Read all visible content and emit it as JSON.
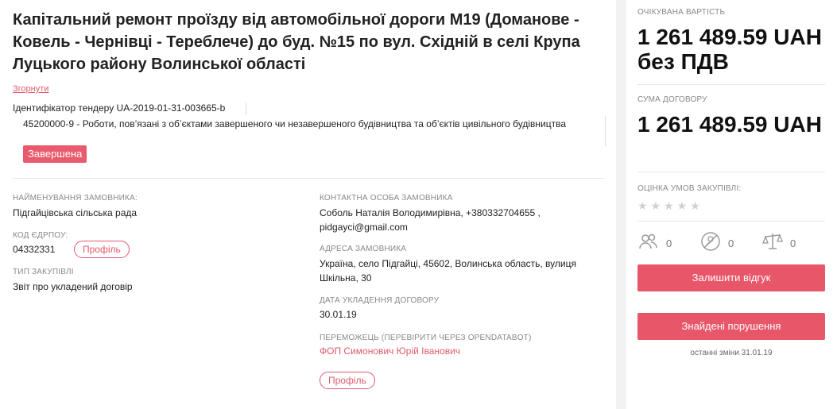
{
  "tender": {
    "title": "Капітальний ремонт проїзду від автомобільної дороги М19 (Доманове - Ковель - Чернівці - Тереблече) до буд. №15 по вул. Східній в селі Крупа Луцького району Волинської області",
    "collapse_label": "Згорнути",
    "tender_id": "Ідентифікатор тендеру UA-2019-01-31-003665-b",
    "cpv": "45200000-9 - Роботи, пов’язані з об’єктами завершеного чи незавершеного будівництва та об’єктів цивільного будівництва",
    "status": "Завершена"
  },
  "details": {
    "customer_label": "НАЙМЕНУВАННЯ ЗАМОВНИКА:",
    "customer_value": "Підгайцівська сільська рада",
    "edrpou_label": "КОД ЄДРПОУ:",
    "edrpou_value": "04332331",
    "profile_label": "Профіль",
    "type_label": "ТИП ЗАКУПІВЛІ",
    "type_value": "Звіт про укладений договір",
    "contact_label": "КОНТАКТНА ОСОБА ЗАМОВНИКА",
    "contact_value": "Соболь Наталія Володимирівна, +380332704655 , pidgayci@gmail.com",
    "address_label": "АДРЕСА ЗАМОВНИКА",
    "address_value": "Україна, село Підгайці, 45602, Волинська область, вулиця Шкільна, 30",
    "date_label": "ДАТА УКЛАДЕННЯ ДОГОВОРУ",
    "date_value": "30.01.19",
    "winner_label": "ПЕРЕМОЖЕЦЬ (ПЕРЕВІРИТИ ЧЕРЕЗ OPENDATABOT)",
    "winner_value": "ФОП Симонович Юрій Іванович",
    "winner_profile_label": "Профіль"
  },
  "aside": {
    "expected_label": "ОЧІКУВАНА ВАРТІСТЬ",
    "expected_value": "1 261 489.59 UAH без ПДВ",
    "contract_label": "СУМА ДОГОВОРУ",
    "contract_value": "1 261 489.59 UAH",
    "rating_label": "ОЦІНКА УМОВ ЗАКУПІВЛІ:",
    "stars": "★★★★★",
    "rating_stars_filled": 0,
    "stat_users": "0",
    "stat_violations": "0",
    "stat_law": "0",
    "feedback_button": "Залишити відгук",
    "violations_button": "Знайдені порушення",
    "last_changes": "останні зміни 31.01.19"
  },
  "colors": {
    "accent": "#e8566a",
    "link": "#e05a6c"
  }
}
